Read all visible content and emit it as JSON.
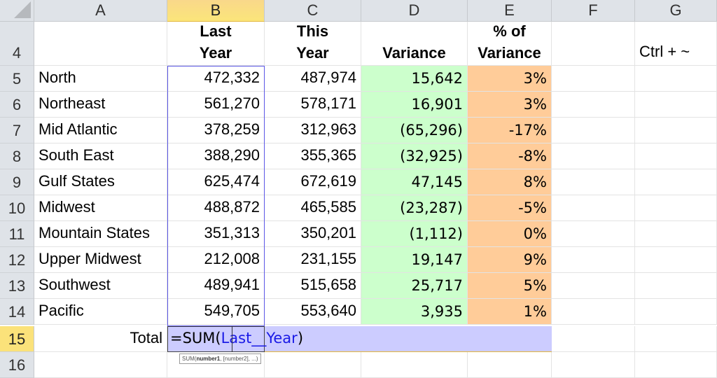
{
  "sheet": {
    "columns": [
      "A",
      "B",
      "C",
      "D",
      "E",
      "F",
      "G"
    ],
    "active_column": "B",
    "active_row": "15",
    "header_row": {
      "row_number": "4",
      "B": "Last Year",
      "B_line1": "Last",
      "B_line2": "Year",
      "C_line1": "This",
      "C_line2": "Year",
      "D": "Variance",
      "E_line1": "% of",
      "E_line2": "Variance",
      "G": "Ctrl + ~"
    },
    "rows": [
      {
        "row": "5",
        "region": "North",
        "last_year": "472,332",
        "this_year": "487,974",
        "variance": "15,642",
        "pct": "3%"
      },
      {
        "row": "6",
        "region": "Northeast",
        "last_year": "561,270",
        "this_year": "578,171",
        "variance": "16,901",
        "pct": "3%"
      },
      {
        "row": "7",
        "region": "Mid Atlantic",
        "last_year": "378,259",
        "this_year": "312,963",
        "variance": "(65,296)",
        "pct": "-17%"
      },
      {
        "row": "8",
        "region": "South East",
        "last_year": "388,290",
        "this_year": "355,365",
        "variance": "(32,925)",
        "pct": "-8%"
      },
      {
        "row": "9",
        "region": "Gulf States",
        "last_year": "625,474",
        "this_year": "672,619",
        "variance": "47,145",
        "pct": "8%"
      },
      {
        "row": "10",
        "region": "Midwest",
        "last_year": "488,872",
        "this_year": "465,585",
        "variance": "(23,287)",
        "pct": "-5%"
      },
      {
        "row": "11",
        "region": "Mountain States",
        "last_year": "351,313",
        "this_year": "350,201",
        "variance": "(1,112)",
        "pct": "0%"
      },
      {
        "row": "12",
        "region": "Upper Midwest",
        "last_year": "212,008",
        "this_year": "231,155",
        "variance": "19,147",
        "pct": "9%"
      },
      {
        "row": "13",
        "region": "Southwest",
        "last_year": "489,941",
        "this_year": "515,658",
        "variance": "25,717",
        "pct": "5%"
      },
      {
        "row": "14",
        "region": "Pacific",
        "last_year": "549,705",
        "this_year": "553,640",
        "variance": "3,935",
        "pct": "1%"
      }
    ],
    "total_row": {
      "row": "15",
      "label": "Total",
      "formula_prefix": "=SUM(",
      "formula_ref": "Last__Year",
      "formula_suffix": ")"
    },
    "next_row": "16",
    "tooltip": {
      "fn": "SUM(",
      "arg1": "number1",
      "rest": ", [number2], ...)"
    },
    "colors": {
      "variance_fill": "#ccffcc",
      "pct_fill": "#ffcc99",
      "edit_fill": "#ccccff",
      "range_border": "#5b57e6",
      "ref_text": "#1a1ae6"
    }
  }
}
